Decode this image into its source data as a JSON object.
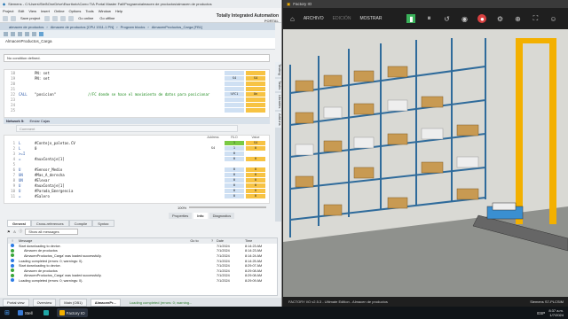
{
  "tia": {
    "window_title": "Siemens - C:\\Users\\Stell\\OneDrive\\Escritorio\\Carro TIA Portal Master Fall\\Programa\\almacen de productos\\almacen de productos",
    "menu": [
      "Project",
      "Edit",
      "View",
      "Insert",
      "Online",
      "Options",
      "Tools",
      "Window",
      "Help"
    ],
    "toolbar": {
      "save_label": "Save project",
      "go_online": "Go online",
      "go_offline": "Go offline"
    },
    "brand": "Totally Integrated Automation",
    "brand_sub": "PORTAL",
    "breadcrumb": [
      "almacen de productos",
      "Almacen de productos [CPU 1511-1 PN]",
      "Program blocks",
      "AlmacenProductos_Carga [FB1]"
    ],
    "block_name": "AlmacenProductos_Carga",
    "condition": "No condition defined.",
    "code1": [
      {
        "ln": "18",
        "ins": "",
        "op": "PN: set",
        "cmt": "",
        "v1": "",
        "v2": ""
      },
      {
        "ln": "19",
        "ins": "",
        "op": "PN: set",
        "cmt": "",
        "v1": "S4",
        "v2": "S4"
      },
      {
        "ln": "20",
        "ins": "",
        "op": "",
        "cmt": "",
        "v1": "",
        "v2": ""
      },
      {
        "ln": "21",
        "ins": "",
        "op": "",
        "cmt": "",
        "v1": "",
        "v2": ""
      },
      {
        "ln": "22",
        "ins": "CALL",
        "op": "\"posicion\"",
        "cmt": "//FC donde se hace el movimiento de datos para posicionar",
        "v1": "%FC1",
        "v2": "On"
      },
      {
        "ln": "23",
        "ins": "",
        "op": "",
        "cmt": "",
        "v1": "",
        "v2": ""
      },
      {
        "ln": "24",
        "ins": "",
        "op": "",
        "cmt": "",
        "v1": "",
        "v2": ""
      },
      {
        "ln": "25",
        "ins": "",
        "op": "",
        "cmt": "",
        "v1": "",
        "v2": ""
      }
    ],
    "network": {
      "label": "Network 5:",
      "title": "Enviar Cajas"
    },
    "comment_placeholder": "Comment",
    "code2_headers": [
      "Address",
      "RLO",
      "Value"
    ],
    "code2": [
      {
        "ln": "1",
        "ins": "L",
        "op": "#Contejo_paletas.CV",
        "v1": "",
        "v2": "1",
        "v3": "S4",
        "c2": "g",
        "c3": "y"
      },
      {
        "ln": "2",
        "ins": "L",
        "op": "0",
        "v1": "S4",
        "v2": "1",
        "v3": "0",
        "c2": "b",
        "c3": "y"
      },
      {
        "ln": "3",
        "ins": ">=I",
        "op": "",
        "v1": "",
        "v2": "0",
        "v3": "",
        "c2": "b",
        "c3": "w"
      },
      {
        "ln": "4",
        "ins": "=",
        "op": "#auxContaje[1]",
        "v1": "",
        "v2": "0",
        "v3": "0",
        "c2": "b",
        "c3": "y"
      },
      {
        "ln": "5",
        "ins": "",
        "op": "",
        "v1": "",
        "v2": "",
        "v3": "",
        "c2": "w",
        "c3": "w"
      },
      {
        "ln": "6",
        "ins": "U",
        "op": "#Sensor_Medio",
        "v1": "",
        "v2": "0",
        "v3": "0",
        "c2": "b",
        "c3": "y"
      },
      {
        "ln": "7",
        "ins": "UN",
        "op": "#Mas_A_derecha",
        "v1": "",
        "v2": "0",
        "v3": "0",
        "c2": "b",
        "c3": "y"
      },
      {
        "ln": "8",
        "ins": "UN",
        "op": "#Elevar",
        "v1": "",
        "v2": "0",
        "v3": "0",
        "c2": "b",
        "c3": "y"
      },
      {
        "ln": "9",
        "ins": "U",
        "op": "#auxContaje[1]",
        "v1": "",
        "v2": "0",
        "v3": "0",
        "c2": "b",
        "c3": "y"
      },
      {
        "ln": "10",
        "ins": "U",
        "op": "#Parada_Emergencia",
        "v1": "",
        "v2": "0",
        "v3": "0",
        "c2": "b",
        "c3": "y"
      },
      {
        "ln": "11",
        "ins": "=",
        "op": "#Salero",
        "v1": "",
        "v2": "0",
        "v3": "0",
        "c2": "b",
        "c3": "y"
      }
    ],
    "zoom": "100%",
    "inspector_tabs": [
      "Properties",
      "Info",
      "Diagnostics"
    ],
    "sub_tabs": [
      "General",
      "Cross-references",
      "Compile",
      "Syntax"
    ],
    "filter_label": "Show all messages",
    "msg_headers": [
      "Message",
      "Go to",
      "?",
      "Date",
      "Time"
    ],
    "messages": [
      {
        "msg": "Start downloading to device.",
        "date": "7/1/2024",
        "time": "8:14:23 AM",
        "ok": true
      },
      {
        "msg": "Almacen de productos",
        "date": "7/1/2024",
        "time": "8:14:23 AM",
        "ok": false
      },
      {
        "msg": "AlmacenProductos_Carga' was loaded successfully.",
        "date": "7/1/2024",
        "time": "8:14:24 AM",
        "ok": false
      },
      {
        "msg": "Loading completed (errors: 0; warnings: 0).",
        "date": "7/1/2024",
        "time": "8:14:25 AM",
        "ok": true
      },
      {
        "msg": "Start downloading to device.",
        "date": "7/1/2024",
        "time": "8:29:07 AM",
        "ok": true
      },
      {
        "msg": "Almacen de productos",
        "date": "7/1/2024",
        "time": "8:29:08 AM",
        "ok": false
      },
      {
        "msg": "AlmacenProductos_Carga' was loaded successfully.",
        "date": "7/1/2024",
        "time": "8:29:08 AM",
        "ok": false
      },
      {
        "msg": "Loading completed (errors: 0; warnings: 0).",
        "date": "7/1/2024",
        "time": "8:29:09 AM",
        "ok": true
      }
    ],
    "portal_tabs": [
      "Portal view",
      "Overview",
      "Main (OB1)",
      "AlmacenPr..."
    ],
    "portal_status": "Loading completed (errors: 0; warning..."
  },
  "fio": {
    "title": "Factory IO",
    "menu": [
      "ARCHIVO",
      "EDICIÓN",
      "MOSTRAR"
    ],
    "status": "FACTORY I/O v2.5.3 - Ultimate Edition - Almacen de productos",
    "driver": "Siemens S7-PLCSIM"
  },
  "side_tabs": [
    "Testing",
    "Tasks",
    "Libraries",
    "Add-ins"
  ],
  "taskbar": {
    "tasks": [
      "Stell",
      "Factory IO"
    ],
    "clock_time": "8:37 a.m.",
    "clock_date": "1/7/2024",
    "lang": "ESP"
  },
  "colors": {
    "tia_accent": "#1a6fb0",
    "value_yellow": "#f7c343",
    "rlo_green": "#7ac943",
    "fio_green": "#3ab15a",
    "fio_red": "#d84040"
  }
}
